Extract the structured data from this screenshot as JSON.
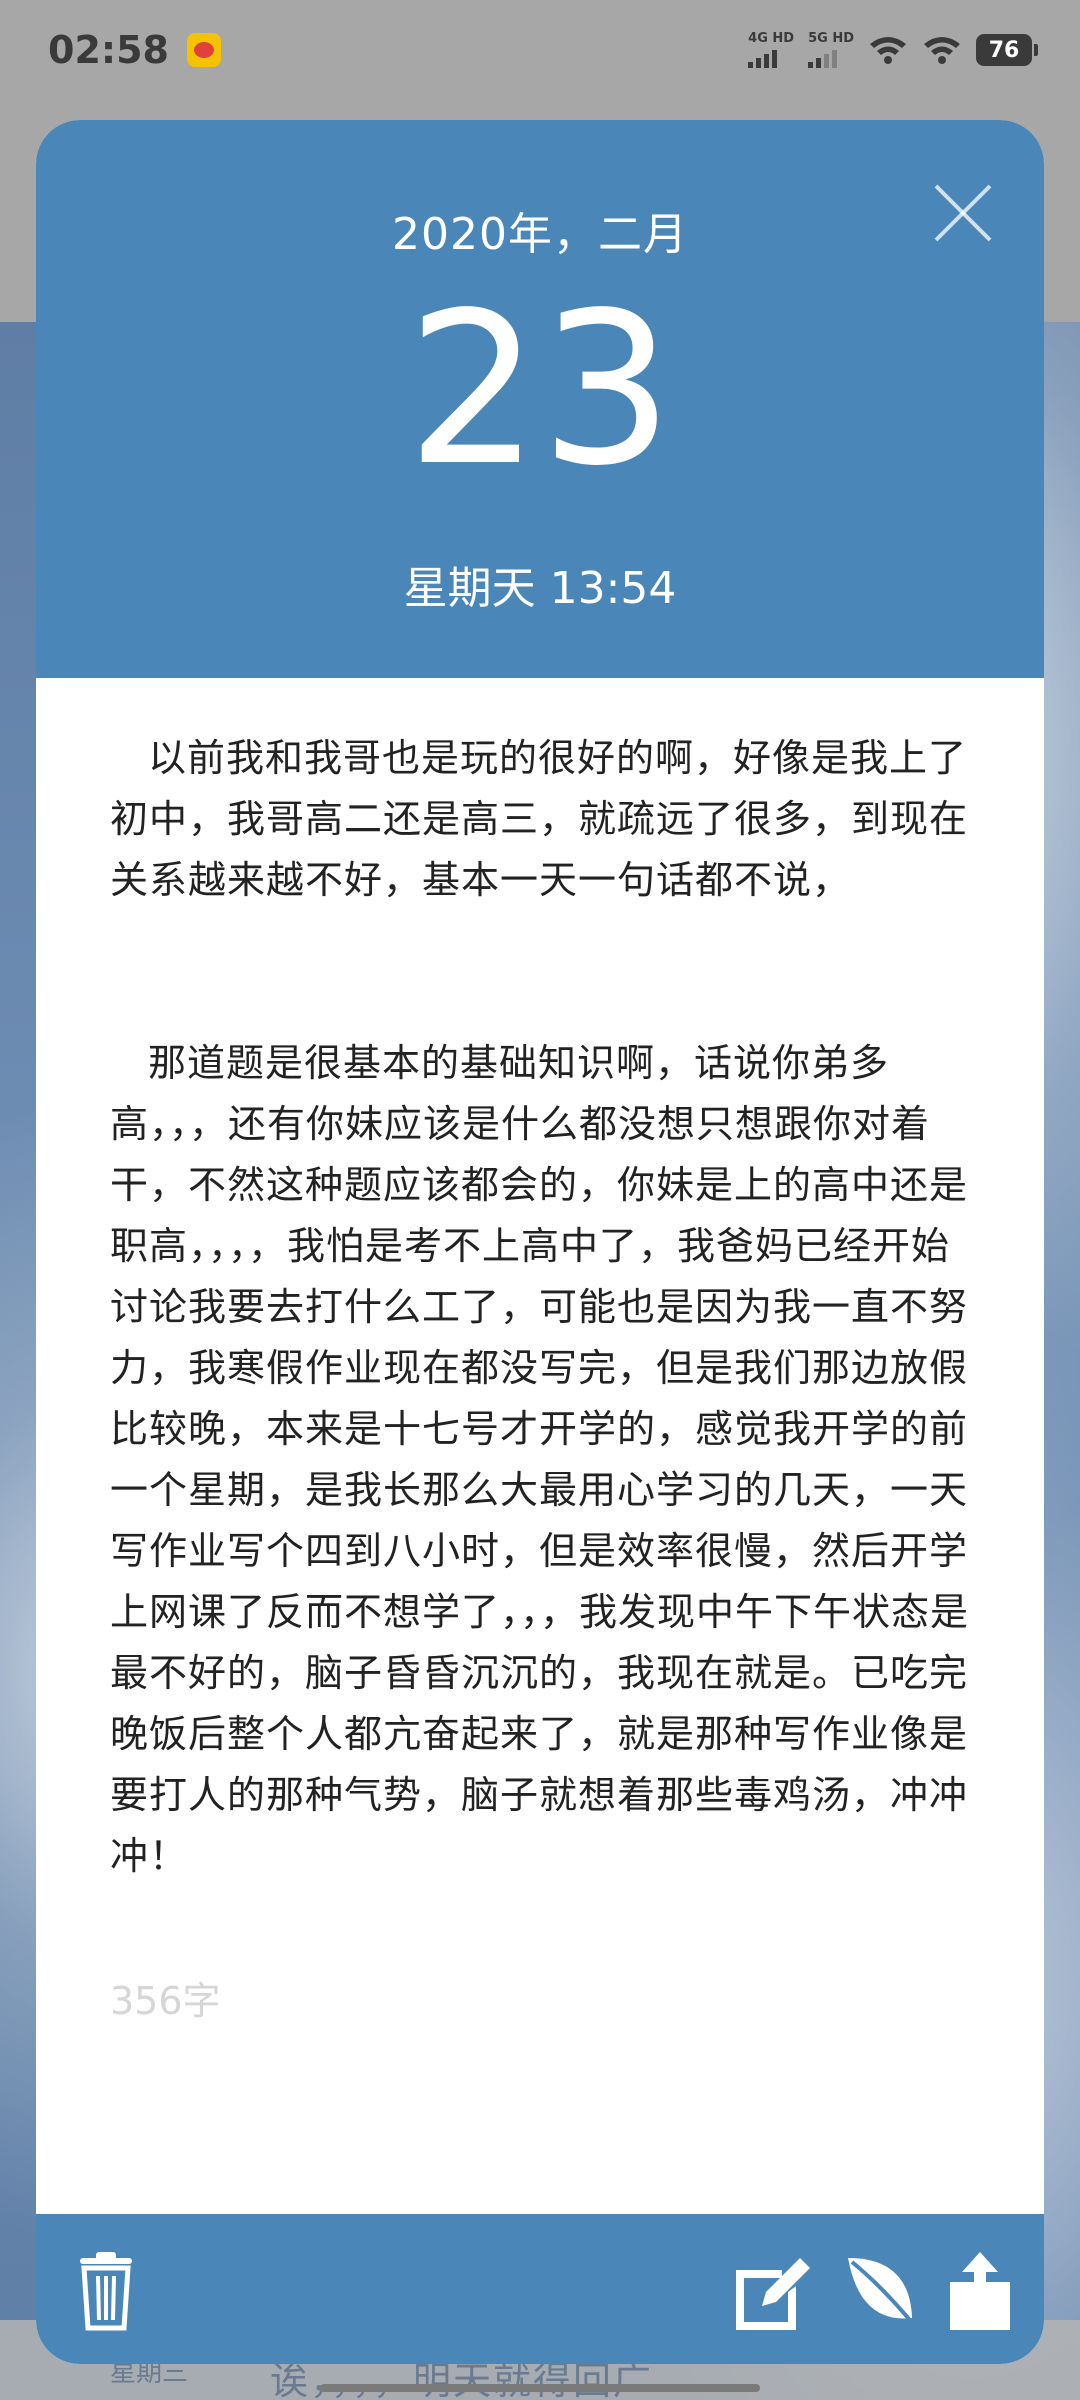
{
  "status_bar": {
    "time": "02:58",
    "signal1_label": "4G HD",
    "signal2_label": "5G HD",
    "battery": "76"
  },
  "background": {
    "weekday": "星期三",
    "preview": "诶，，，，明天就得回广"
  },
  "header": {
    "year_month": "2020年，二月",
    "day": "23",
    "weekday_time": "星期天 13:54"
  },
  "body": {
    "paragraph1": "以前我和我哥也是玩的很好的啊，好像是我上了初中，我哥高二还是高三，就疏远了很多，到现在关系越来越不好，基本一天一句话都不说，",
    "paragraph2": "那道题是很基本的基础知识啊，话说你弟多高，，，还有你妹应该是什么都没想只想跟你对着干，不然这种题应该都会的，你妹是上的高中还是职高，，，，我怕是考不上高中了，我爸妈已经开始讨论我要去打什么工了，可能也是因为我一直不努力，我寒假作业现在都没写完，但是我们那边放假比较晚，本来是十七号才开学的，感觉我开学的前一个星期，是我长那么大最用心学习的几天，一天写作业写个四到八小时，但是效率很慢，然后开学上网课了反而不想学了，，，我发现中午下午状态是最不好的，脑子昏昏沉沉的，我现在就是。已吃完晚饭后整个人都亢奋起来了，就是那种写作业像是要打人的那种气势，脑子就想着那些毒鸡汤，冲冲冲！",
    "word_count": "356字"
  },
  "footer": {
    "icons": [
      "trash-icon",
      "edit-icon",
      "leaf-icon",
      "share-icon"
    ]
  },
  "colors": {
    "accent": "#4a87b8",
    "word_count": "#d6d6d6"
  }
}
